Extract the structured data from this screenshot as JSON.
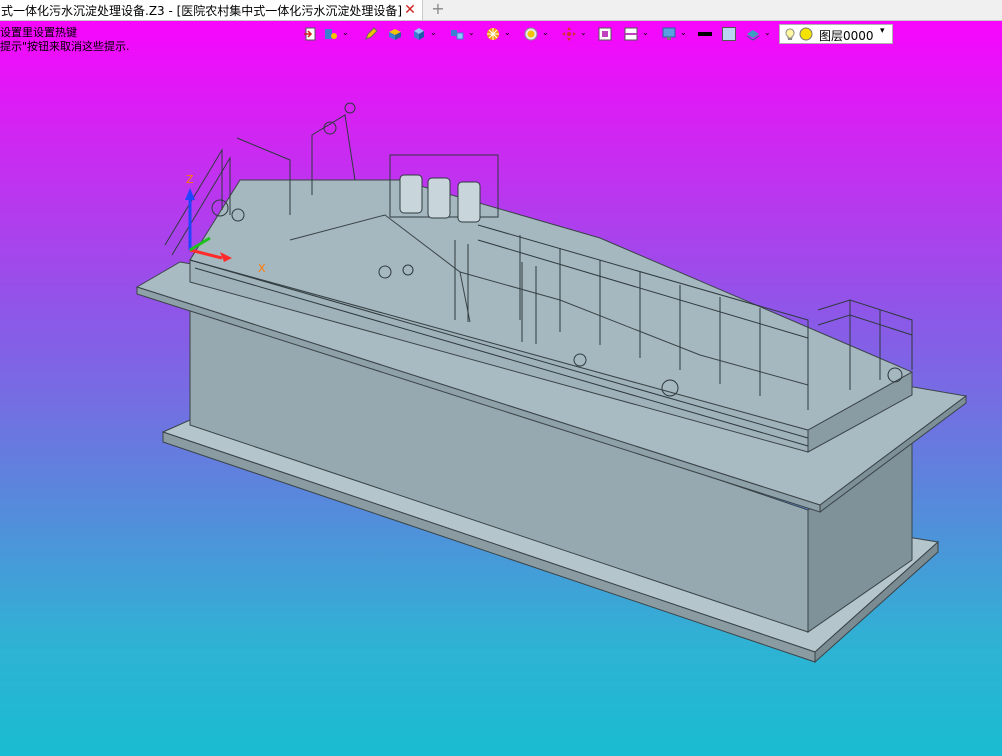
{
  "document_tab": {
    "title": "式一体化污水沉淀处理设备.Z3 - [医院农村集中式一体化污水沉淀处理设备]",
    "close_glyph": "✕",
    "new_tab_glyph": "+"
  },
  "hints": [
    "设置里设置热键",
    "提示\"按钮来取消这些提示."
  ],
  "toolbar": {
    "icons": [
      "insert-icon",
      "attach-icon",
      "pencil-icon",
      "box-icon",
      "cube-icon",
      "component-icon",
      "wheel-icon",
      "target-icon",
      "move-icon",
      "frame-icon",
      "screen-icon",
      "display-icon",
      "line-color-icon",
      "fill-color-icon",
      "material-icon"
    ],
    "dropdown_glyph": "⌄",
    "colors": {
      "accent_blue": "#3a7fd0",
      "accent_yellow": "#f2c400",
      "accent_orange": "#f08a00"
    }
  },
  "layer_selector": {
    "value": "图层0000",
    "dropdown_glyph": "▾"
  },
  "triad": {
    "z_label": "Z",
    "x_label": "X",
    "colors": {
      "z": "#2244ff",
      "x": "#ff2a2a",
      "y": "#1ec21e",
      "label": "#ff7a00"
    }
  },
  "viewport_colors": {
    "top": "#ff00ff",
    "bottom": "#19bcd2",
    "model_face": "#a4b6bd",
    "model_dark": "#8ea2aa"
  }
}
